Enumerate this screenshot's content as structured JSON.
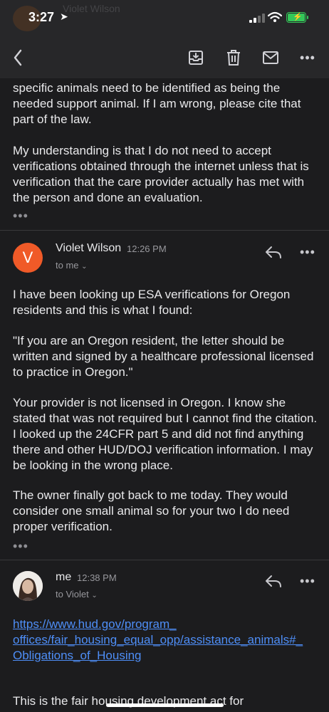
{
  "status": {
    "time": "3:27"
  },
  "ghost": {
    "name": "Violet Wilson"
  },
  "first_email": {
    "paragraphs": [
      "specific animals need to be identified as being the needed support animal.  If  I am wrong, please cite that part of the law.",
      "My understanding is that I do not need to accept verifications obtained through the internet unless that is verification that the care provider actually has met with the person and done an evaluation."
    ]
  },
  "second_email": {
    "avatar_letter": "V",
    "sender": "Violet Wilson",
    "time": "12:26 PM",
    "to": "to me",
    "paragraphs": [
      "I have been looking up ESA verifications for Oregon residents and this is what I found:",
      "\"If you are an Oregon resident, the letter should be written and signed by a healthcare professional licensed to practice in Oregon.\"",
      "Your provider is not licensed in Oregon.  I know she stated that was not required but I cannot find the citation.  I looked up the 24CFR part 5 and did not find anything there and other HUD/DOJ verification information.  I may be looking in the wrong place.",
      "The owner finally got back to me today.  They would consider one small animal so for your two I do need proper verification."
    ]
  },
  "third_email": {
    "sender": "me",
    "time": "12:38 PM",
    "to": "to Violet",
    "link_lines": [
      "https://www.hud.gov/program_",
      "offices/fair_housing_equal_opp/assistance_animals#_",
      "Obligations_of_Housing"
    ],
    "tail": "This is the fair housing development act for"
  }
}
